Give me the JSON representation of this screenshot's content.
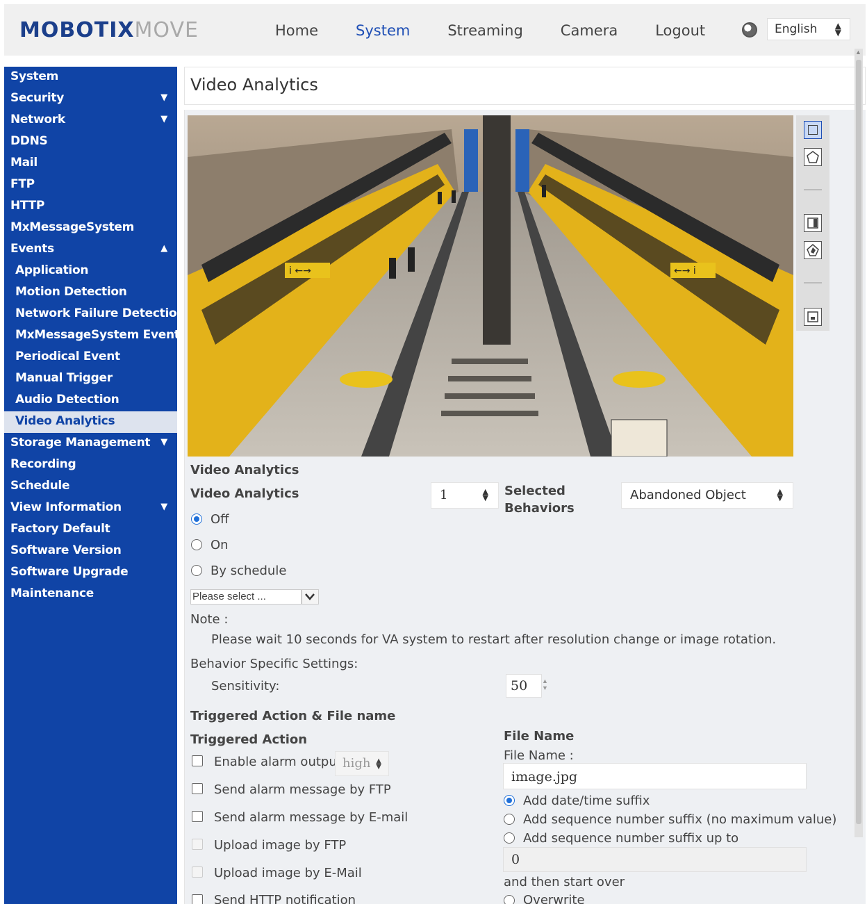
{
  "header": {
    "logo_primary": "MOBOTIX",
    "logo_secondary": "MOVE",
    "nav": [
      {
        "label": "Home",
        "active": false
      },
      {
        "label": "System",
        "active": true
      },
      {
        "label": "Streaming",
        "active": false
      },
      {
        "label": "Camera",
        "active": false
      },
      {
        "label": "Logout",
        "active": false
      }
    ],
    "language": "English"
  },
  "sidebar": {
    "items": [
      {
        "label": "System",
        "sub": false,
        "caret": ""
      },
      {
        "label": "Security",
        "sub": false,
        "caret": "▼"
      },
      {
        "label": "Network",
        "sub": false,
        "caret": "▼"
      },
      {
        "label": "DDNS",
        "sub": false,
        "caret": ""
      },
      {
        "label": "Mail",
        "sub": false,
        "caret": ""
      },
      {
        "label": "FTP",
        "sub": false,
        "caret": ""
      },
      {
        "label": "HTTP",
        "sub": false,
        "caret": ""
      },
      {
        "label": "MxMessageSystem",
        "sub": false,
        "caret": ""
      },
      {
        "label": "Events",
        "sub": false,
        "caret": "▲"
      },
      {
        "label": "Application",
        "sub": true,
        "caret": ""
      },
      {
        "label": "Motion Detection",
        "sub": true,
        "caret": ""
      },
      {
        "label": "Network Failure Detection",
        "sub": true,
        "caret": ""
      },
      {
        "label": "MxMessageSystem Event",
        "sub": true,
        "caret": ""
      },
      {
        "label": "Periodical Event",
        "sub": true,
        "caret": ""
      },
      {
        "label": "Manual Trigger",
        "sub": true,
        "caret": ""
      },
      {
        "label": "Audio Detection",
        "sub": true,
        "caret": ""
      },
      {
        "label": "Video Analytics",
        "sub": true,
        "caret": "",
        "active": true
      },
      {
        "label": "Storage Management",
        "sub": false,
        "caret": "▼"
      },
      {
        "label": "Recording",
        "sub": false,
        "caret": ""
      },
      {
        "label": "Schedule",
        "sub": false,
        "caret": ""
      },
      {
        "label": "View Information",
        "sub": false,
        "caret": "▼"
      },
      {
        "label": "Factory Default",
        "sub": false,
        "caret": ""
      },
      {
        "label": "Software Version",
        "sub": false,
        "caret": ""
      },
      {
        "label": "Software Upgrade",
        "sub": false,
        "caret": ""
      },
      {
        "label": "Maintenance",
        "sub": false,
        "caret": ""
      }
    ]
  },
  "page": {
    "title": "Video Analytics"
  },
  "camera": {
    "sign_left": "i ←→",
    "sign_right": "←→ i"
  },
  "toolstrip": {
    "tools": [
      "rectangle-tool-icon",
      "polygon-tool-icon",
      "rectangle-exclude-icon",
      "polygon-exclude-icon",
      "minimize-icon"
    ]
  },
  "va": {
    "section_title": "Video Analytics",
    "field_label": "Video Analytics",
    "instance_value": "1",
    "selected_behaviors_label_1": "Selected",
    "selected_behaviors_label_2": "Behaviors",
    "behavior_value": "Abandoned Object",
    "radio_off": "Off",
    "radio_on": "On",
    "radio_schedule": "By schedule",
    "schedule_placeholder": "Please select ...",
    "note_label": "Note :",
    "note_text": "Please wait 10 seconds for VA system to restart after resolution change or image rotation.",
    "behavior_settings_label": "Behavior Specific Settings:",
    "sensitivity_label": "Sensitivity:",
    "sensitivity_value": "50"
  },
  "actions": {
    "section_title": "Triggered Action & File name",
    "triggered_title": "Triggered Action",
    "enable_alarm": "Enable alarm output",
    "alarm_level": "high",
    "ftp_msg": "Send alarm message by FTP",
    "email_msg": "Send alarm message by E-mail",
    "upload_ftp": "Upload image by FTP",
    "upload_email": "Upload image by E-Mail",
    "http_notify": "Send HTTP notification"
  },
  "file": {
    "title": "File Name",
    "label": "File Name :",
    "value": "image.jpg",
    "opt_datetime": "Add date/time suffix",
    "opt_seq_nomax": "Add sequence number suffix (no maximum value)",
    "opt_seq_upto": "Add sequence number suffix up to",
    "upto_value": "0",
    "then_text": "and then start over",
    "overwrite": "Overwrite"
  }
}
